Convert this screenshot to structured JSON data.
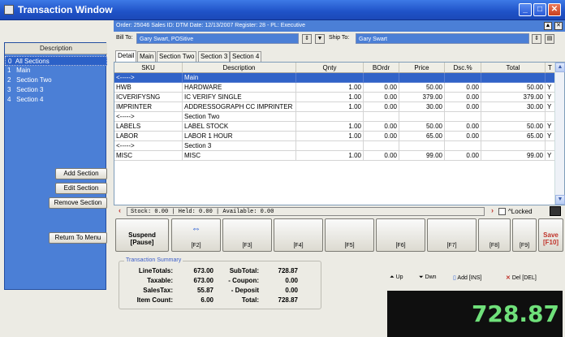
{
  "window": {
    "title": "Transaction Window"
  },
  "order_info": "Order: 25046  Sales ID: DTM  Date: 12/13/2007  Register: 28 - PL: Executive",
  "bill_to": {
    "label": "Bill To:",
    "value": "Gary Swart, POSitive"
  },
  "ship_to": {
    "label": "Ship To:",
    "value": "Gary Swart"
  },
  "left_panel": {
    "header": "Description",
    "items": [
      {
        "num": "0",
        "label": "All Sections"
      },
      {
        "num": "1",
        "label": "Main"
      },
      {
        "num": "2",
        "label": "Section Two"
      },
      {
        "num": "3",
        "label": "Section 3"
      },
      {
        "num": "4",
        "label": "Section 4"
      }
    ],
    "buttons": {
      "add": "Add Section",
      "edit": "Edit Section",
      "remove": "Remove Section",
      "return": "Return To Menu"
    }
  },
  "tabs": [
    "Detail",
    "Main",
    "Section Two",
    "Section 3",
    "Section 4"
  ],
  "grid": {
    "columns": [
      "SKU",
      "Description",
      "Qnty",
      "BOrdr",
      "Price",
      "Dsc.%",
      "Total",
      "T"
    ],
    "rows": [
      [
        "<----->",
        "Main",
        "",
        "",
        "",
        "",
        "",
        ""
      ],
      [
        "HWB",
        "HARDWARE",
        "1.00",
        "0.00",
        "50.00",
        "0.00",
        "50.00",
        "Y"
      ],
      [
        "ICVERIFYSNG",
        "IC VERIFY SINGLE",
        "1.00",
        "0.00",
        "379.00",
        "0.00",
        "379.00",
        "Y"
      ],
      [
        "IMPRINTER",
        "ADDRESSOGRAPH CC IMPRINTER",
        "1.00",
        "0.00",
        "30.00",
        "0.00",
        "30.00",
        "Y"
      ],
      [
        "<----->",
        "Section Two",
        "",
        "",
        "",
        "",
        "",
        ""
      ],
      [
        "LABELS",
        "LABEL STOCK",
        "1.00",
        "0.00",
        "50.00",
        "0.00",
        "50.00",
        "Y"
      ],
      [
        "LABOR",
        "LABOR 1 HOUR",
        "1.00",
        "0.00",
        "65.00",
        "0.00",
        "65.00",
        "Y"
      ],
      [
        "<----->",
        "Section 3",
        "",
        "",
        "",
        "",
        "",
        ""
      ],
      [
        "MISC",
        "MISC",
        "1.00",
        "0.00",
        "99.00",
        "0.00",
        "99.00",
        "Y"
      ]
    ]
  },
  "stock_line": "Stock:          0.00 | Held:          0.00 | Available:          0.00",
  "locked_label": "^Locked",
  "fkeys": {
    "suspend": "Suspend",
    "suspend_sub": "[Pause]",
    "f2": "[F2]",
    "f3": "[F3]",
    "f4": "[F4]",
    "f5": "[F5]",
    "f6": "[F6]",
    "f7": "[F7]",
    "f8": "[F8]",
    "f9": "[F9]",
    "save": "Save",
    "save_sub": "[F10]"
  },
  "summary": {
    "legend": "Transaction Summary",
    "line_totals_label": "LineTotals:",
    "line_totals": "673.00",
    "taxable_label": "Taxable:",
    "taxable": "673.00",
    "salestax_label": "SalesTax:",
    "salestax": "55.87",
    "item_count_label": "Item Count:",
    "item_count": "6.00",
    "subtotal_label": "SubTotal:",
    "subtotal": "728.87",
    "coupon_label": "- Coupon:",
    "coupon": "0.00",
    "deposit_label": "- Deposit",
    "deposit": "0.00",
    "total_label": "Total:",
    "total": "728.87"
  },
  "nav": {
    "up": "Up",
    "down": "Dwn",
    "add": "Add [INS]",
    "del": "Del [DEL]"
  },
  "big_total": "728.87",
  "colors": {
    "title_blue": "#2a5ed6",
    "panel_blue": "#4b7fd6",
    "selected_row": "#3163c8",
    "total_green": "#6fe07a"
  }
}
